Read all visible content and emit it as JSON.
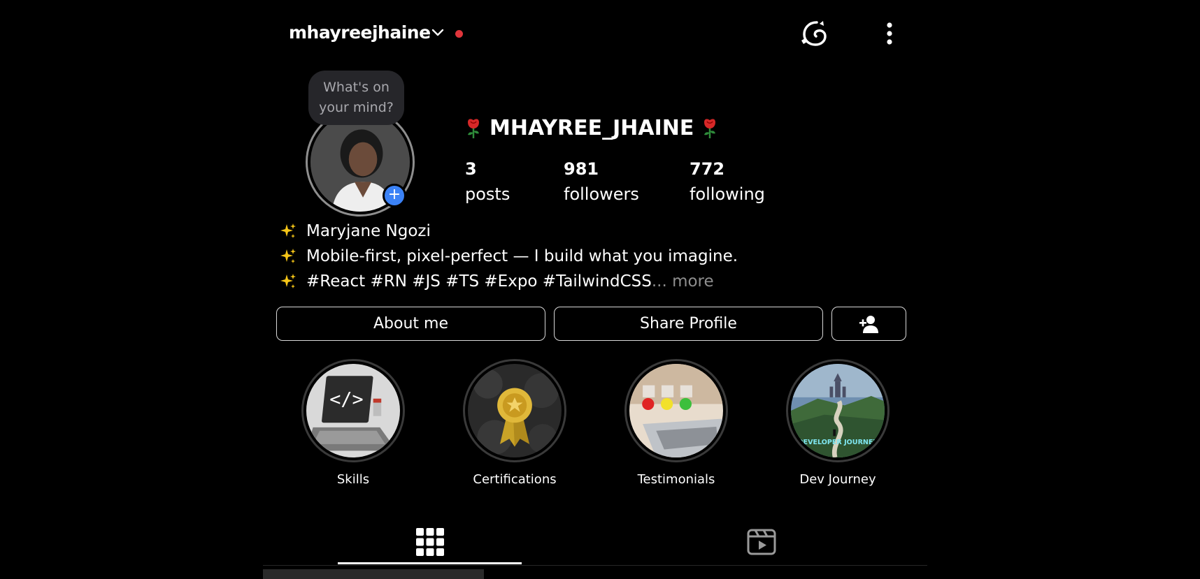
{
  "header": {
    "username": "mhayreejhaine",
    "icons": {
      "switch": "chevron-down-icon",
      "status": "live-dot",
      "logo": "threads-logo-icon",
      "menu": "more-vertical-icon"
    },
    "colors": {
      "status_dot": "#e0353b"
    }
  },
  "note": {
    "text": "What's on your mind?"
  },
  "profile": {
    "display_name": "MHAYREE_JHAINE",
    "name_decoration_icon": "rose-icon",
    "add_story_badge": "+",
    "stats": [
      {
        "value": "3",
        "label": "posts"
      },
      {
        "value": "981",
        "label": "followers"
      },
      {
        "value": "772",
        "label": "following"
      }
    ]
  },
  "bio": {
    "bullet_icon": "sparkles-icon",
    "lines": [
      "Maryjane Ngozi",
      "Mobile-first, pixel-perfect — I build what you imagine.",
      "#React #RN #JS #TS #Expo #TailwindCSS"
    ],
    "more": "... more"
  },
  "actions": {
    "about": "About me",
    "share": "Share Profile",
    "add_person_icon": "add-person-icon"
  },
  "highlights": [
    {
      "label": "Skills"
    },
    {
      "label": "Certifications"
    },
    {
      "label": "Testimonials"
    },
    {
      "label": "Dev Journey"
    }
  ],
  "highlight_image_text": {
    "journey": "DEVELOPER JOURNEY"
  },
  "tabs": [
    {
      "icon": "grid-icon",
      "active": true
    },
    {
      "icon": "reels-icon",
      "active": false
    }
  ],
  "colors": {
    "accent_blue": "#3b82f6",
    "background": "#000000",
    "muted": "#8e8e8e"
  }
}
